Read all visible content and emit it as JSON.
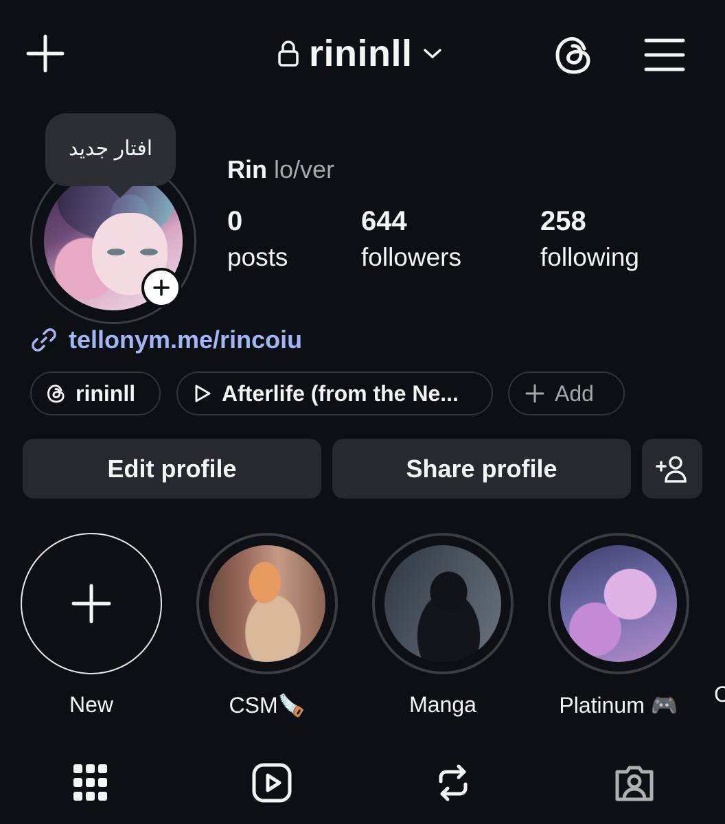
{
  "header": {
    "username": "rininll",
    "icons": {
      "new_post": "plus-icon",
      "lock": "lock-icon",
      "switch": "chevron-down-icon",
      "threads": "threads-icon",
      "menu": "hamburger-menu-icon"
    }
  },
  "profile": {
    "tooltip": "افتار جديد",
    "name": "Rin",
    "pronouns": "lo/ver",
    "stats": [
      {
        "value": "0",
        "label": "posts"
      },
      {
        "value": "644",
        "label": "followers"
      },
      {
        "value": "258",
        "label": "following"
      }
    ],
    "link": "tellonym.me/rincoiu"
  },
  "chips": {
    "threads": "rininll",
    "music": "Afterlife (from the Ne...",
    "add": "Add"
  },
  "actions": {
    "edit": "Edit profile",
    "share": "Share profile"
  },
  "highlights": [
    {
      "label": "New"
    },
    {
      "label": "CSM🪚"
    },
    {
      "label": "Manga"
    },
    {
      "label": "Platinum 🎮"
    },
    {
      "label": "C"
    }
  ],
  "tabs": [
    "grid-icon",
    "reels-icon",
    "reposts-icon",
    "tagged-icon"
  ],
  "colors": {
    "background": "#0c0f14",
    "surface": "#26292f",
    "link": "#a2b5f5"
  }
}
